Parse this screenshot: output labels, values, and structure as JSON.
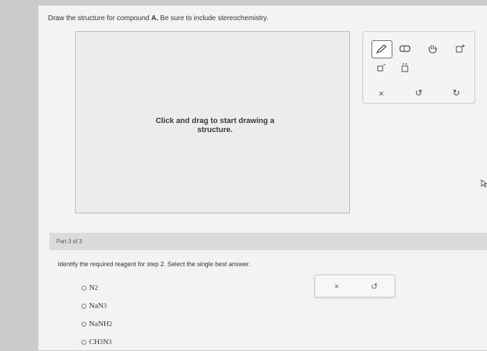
{
  "instruction": {
    "prefix": "Draw the structure for compound ",
    "compound": "A.",
    "suffix": " Be sure to include stereochemistry."
  },
  "canvas": {
    "hint_line1": "Click and drag to start drawing a",
    "hint_line2": "structure."
  },
  "toolbar": {
    "tools": [
      {
        "name": "pencil-icon",
        "active": true
      },
      {
        "name": "eraser-icon",
        "active": false
      },
      {
        "name": "hand-icon",
        "active": false
      },
      {
        "name": "charge-plus-icon",
        "active": false
      },
      {
        "name": "charge-minus-icon",
        "active": false
      },
      {
        "name": "lone-pair-icon",
        "active": false
      },
      {
        "name": "clear-icon",
        "active": false
      },
      {
        "name": "undo-icon",
        "active": false
      },
      {
        "name": "redo-icon",
        "active": false
      }
    ]
  },
  "part": {
    "label": "Part 3 of 3"
  },
  "question": {
    "text": "Identify the required reagent for step 2. Select the single best answer."
  },
  "options": [
    {
      "base": "N",
      "sub": "2",
      "rest": ""
    },
    {
      "base": "NaN",
      "sub": "3",
      "rest": ""
    },
    {
      "base": "NaNH",
      "sub": "2",
      "rest": ""
    },
    {
      "base": "CH",
      "sub": "3",
      "rest": "N",
      "sub2": "3"
    }
  ],
  "actions": {
    "clear": "×",
    "undo": "↺"
  }
}
